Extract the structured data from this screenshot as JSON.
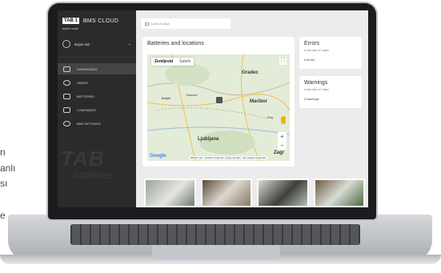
{
  "side_text": [
    "n",
    "anlı",
    "sı",
    "e"
  ],
  "brand": {
    "logo_box": "TAB 1",
    "app_name": "BMS CLOUD",
    "subtitle": "Admin mode"
  },
  "user": {
    "name": "Bojan tab"
  },
  "sidebar": {
    "items": [
      {
        "label": "DASHBOARD",
        "icon": "speedometer-icon",
        "active": true
      },
      {
        "label": "USERS",
        "icon": "user-icon",
        "active": false
      },
      {
        "label": "BATTERIES",
        "icon": "battery-icon",
        "active": false
      },
      {
        "label": "COMPANIES",
        "icon": "building-icon",
        "active": false
      },
      {
        "label": "BMS SETTINGS",
        "icon": "gear-icon",
        "active": false
      }
    ],
    "watermark": "TAB",
    "watermark_sub": "batteries"
  },
  "filter": {
    "label": "Last 10 days"
  },
  "map_card": {
    "title": "Batteries and locations",
    "tabs": [
      "Zemljevid",
      "Satelit"
    ],
    "active_tab": "Zemljevid",
    "cities": [
      "Gradec",
      "Celovec",
      "Beljak",
      "Maribor",
      "Ljubljana",
      "Zagr",
      "Ptuj"
    ],
    "footer": "Bližnjice tipk · Podatki zemljevida · Pogoji uporabe · Javi napako zemljevida",
    "google": "Google"
  },
  "errors_card": {
    "title": "Errors",
    "sub": "in the last 10 days",
    "count": "0 errors"
  },
  "warnings_card": {
    "title": "Warnings",
    "sub": "in the last 10 days",
    "count": "0 warnings"
  },
  "colors": {
    "sidebar": "#2b2b2b",
    "content_bg": "#ececec",
    "accent_map": "#dfe9d6"
  }
}
